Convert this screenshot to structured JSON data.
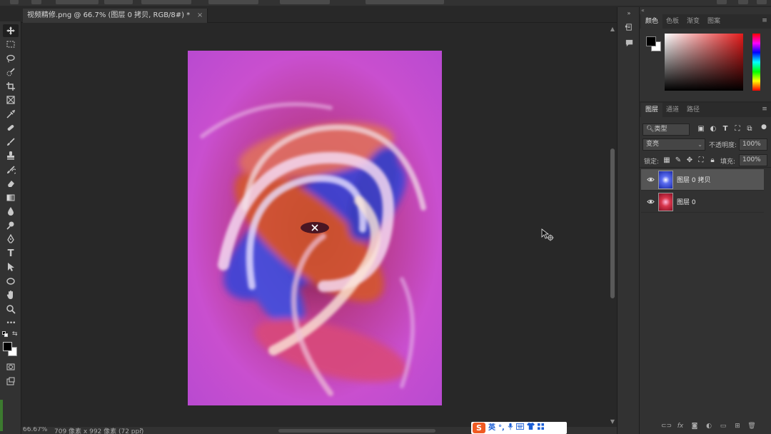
{
  "document": {
    "tab_title": "视频精修.png @ 66.7% (图层 0 拷贝, RGB/8#) *",
    "close_glyph": "×"
  },
  "status_bar": {
    "zoom": "66.67%",
    "doc_size": "709 像素 x 992 像素 (72 ppi)",
    "arrow": "›"
  },
  "color_panel": {
    "tabs": [
      "颜色",
      "色板",
      "渐变",
      "图案"
    ],
    "foreground_color": "#000000",
    "background_color": "#ffffff"
  },
  "layers_panel": {
    "tabs": [
      "图层",
      "通道",
      "路径"
    ],
    "filter_kind": "类型",
    "blend_mode": "变亮",
    "opacity_label": "不透明度:",
    "opacity_value": "100%",
    "lock_label": "锁定:",
    "fill_label": "填充:",
    "fill_value": "100%",
    "layers": [
      {
        "name": "图层 0 拷贝",
        "selected": true,
        "thumb_color": "#3b4fd8"
      },
      {
        "name": "图层 0",
        "selected": false,
        "thumb_color": "#c8243a"
      }
    ],
    "bottom_icons": [
      "link-icon",
      "fx-icon",
      "mask-icon",
      "adjustment-icon",
      "group-icon",
      "new-layer-icon",
      "trash-icon"
    ],
    "fx_label": "fx"
  },
  "ime_bar": {
    "logo": "S",
    "lang": "英",
    "items": [
      "°,",
      "🎤",
      "⌨",
      "👕",
      "▦"
    ]
  },
  "tools": [
    "move-tool-icon",
    "marquee-tool-icon",
    "lasso-tool-icon",
    "quick-select-tool-icon",
    "crop-tool-icon",
    "frame-tool-icon",
    "eyedropper-tool-icon",
    "healing-brush-icon",
    "brush-tool-icon",
    "clone-stamp-icon",
    "history-brush-icon",
    "eraser-tool-icon",
    "gradient-tool-icon",
    "blur-tool-icon",
    "dodge-tool-icon",
    "pen-tool-icon",
    "type-tool-icon",
    "path-select-icon",
    "ellipse-tool-icon",
    "hand-tool-icon",
    "zoom-tool-icon",
    "more-tools-icon"
  ],
  "type_tool_glyph": "T",
  "more_tools_glyph": "•••"
}
